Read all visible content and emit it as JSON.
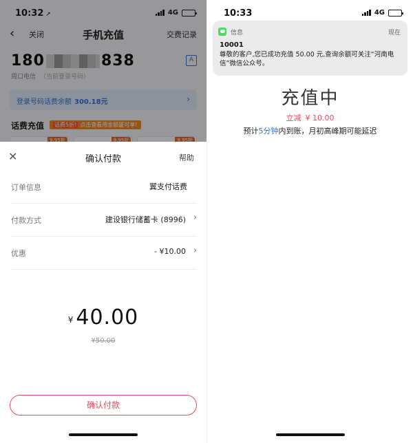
{
  "left": {
    "status": {
      "time": "10:32",
      "network": "4G"
    },
    "nav": {
      "back": "‹",
      "close": "关闭",
      "title": "手机充值",
      "record": "交费记录"
    },
    "phone": {
      "prefix": "180",
      "suffix": "838",
      "carrier": "周口电信",
      "hint": "（当前登录号码）"
    },
    "balance": {
      "label": "登录号码话费余额",
      "amount": "300.18元"
    },
    "topup": {
      "heading": "话费充值",
      "promo_hl": "话费5折!",
      "promo": "点击查看用金额厦可享!",
      "tiles": [
        "9.95折",
        "9.95折",
        "9.95折"
      ]
    },
    "sheet": {
      "title": "确认付款",
      "help": "帮助",
      "order_label": "订单信息",
      "order_value": "翼支付话费",
      "pay_label": "付款方式",
      "pay_value": "建设银行储蓄卡 (8996)",
      "discount_label": "优惠",
      "discount_value": "- ¥10.00",
      "currency": "¥",
      "amount": "40.00",
      "original": "¥50.00",
      "confirm": "确认付款"
    }
  },
  "right": {
    "status": {
      "time": "10:33",
      "network": "4G"
    },
    "notification": {
      "app": "信息",
      "when": "现在",
      "sender": "10001",
      "message": "尊敬的客户,您已成功充值 50.00 元,查询余额可关注“河南电信”微信公众号。"
    },
    "state": "充值中",
    "discount_label": "立减",
    "discount_value": "¥ 10.00",
    "eta_pre": "预计",
    "eta_hl": "5分钟",
    "eta_post": "内到账，月初高峰期可能延迟"
  },
  "colors": {
    "accent_red": "#e94b5b",
    "accent_blue": "#3b6fd8",
    "promo_orange": "#f08a24"
  },
  "battery_level": 0.85
}
